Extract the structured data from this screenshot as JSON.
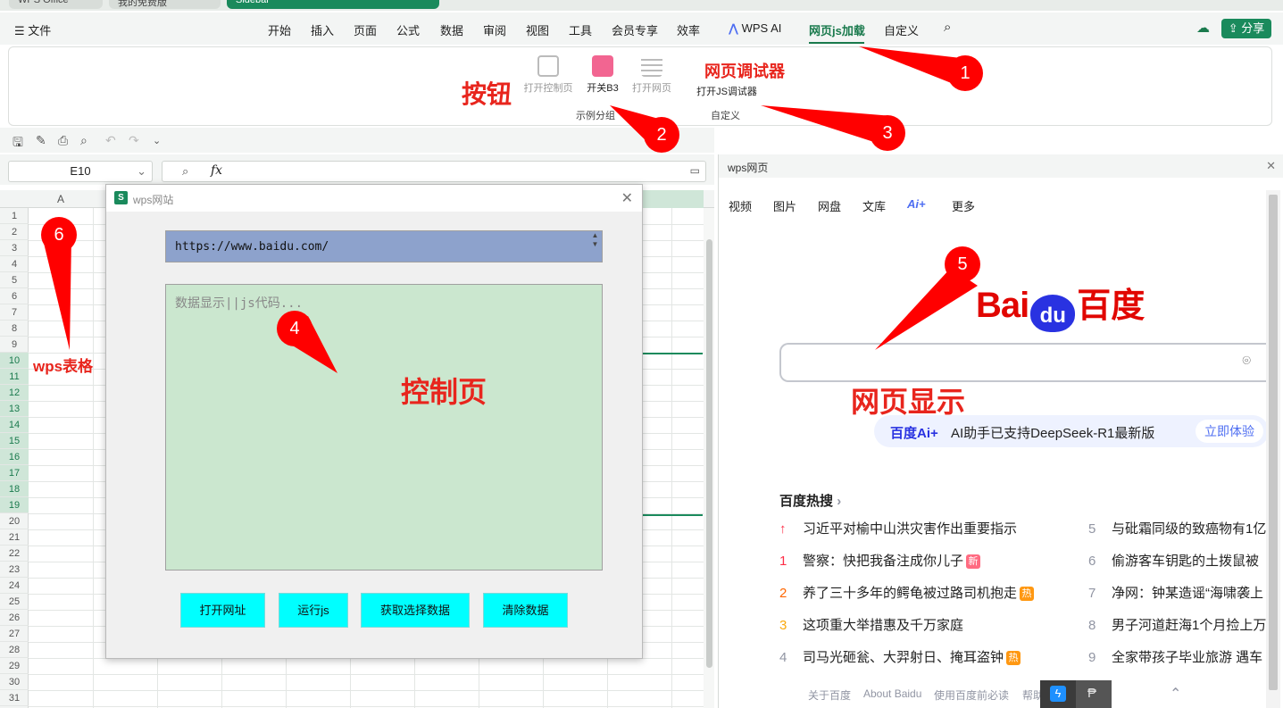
{
  "window_tabs": [
    "WPS Office",
    "我的免费版",
    "Sidebar"
  ],
  "file_menu": "文件",
  "menu": [
    "开始",
    "插入",
    "页面",
    "公式",
    "数据",
    "审阅",
    "视图",
    "工具",
    "会员专享",
    "效率",
    "WPS AI",
    "网页js加载",
    "自定义"
  ],
  "share_label": "分享",
  "ribbon": {
    "buttons": [
      {
        "label": "打开控制页",
        "enabled": false
      },
      {
        "label": "开关B3",
        "enabled": true
      },
      {
        "label": "打开网页",
        "enabled": false
      },
      {
        "label": "打开JS调试器",
        "enabled": true
      }
    ],
    "group_left": "示例分组",
    "group_right": "自定义"
  },
  "formula_bar": {
    "cell_ref": "E10",
    "fx": "fx"
  },
  "sheet": {
    "col_a": "A",
    "rows": [
      "1",
      "2",
      "3",
      "4",
      "5",
      "6",
      "7",
      "8",
      "9",
      "10",
      "11",
      "12",
      "13",
      "14",
      "15",
      "16",
      "17",
      "18",
      "19",
      "20",
      "21",
      "22",
      "23",
      "24",
      "25",
      "26",
      "27",
      "28",
      "29",
      "30",
      "31"
    ],
    "selected_rows_from": 10,
    "selected_rows_to": 19
  },
  "dialog": {
    "title": "wps网站",
    "url": "https://www.baidu.com/",
    "code_placeholder": "数据显示||js代码...",
    "buttons": [
      "打开网址",
      "运行js",
      "获取选择数据",
      "清除数据"
    ]
  },
  "webpane": {
    "title": "wps网页",
    "nav": [
      "视频",
      "图片",
      "网盘",
      "文库",
      "Ai+",
      "更多"
    ],
    "logo_left": "Bai",
    "logo_mid": "du",
    "logo_right": "百度",
    "ai_promo": {
      "brand": "百度Ai+",
      "text": "AI助手已支持DeepSeek-R1最新版",
      "cta": "立即体验"
    },
    "hot_title": "百度热搜",
    "hot_left": [
      {
        "n": "↑",
        "text": "习近平对榆中山洪灾害作出重要指示",
        "badge": ""
      },
      {
        "n": "1",
        "text": "警察：快把我备注成你儿子",
        "badge": "新"
      },
      {
        "n": "2",
        "text": "养了三十多年的鳄龟被过路司机抱走",
        "badge": "热"
      },
      {
        "n": "3",
        "text": "这项重大举措惠及千万家庭",
        "badge": ""
      },
      {
        "n": "4",
        "text": "司马光砸瓮、大羿射日、掩耳盗钟",
        "badge": "热"
      }
    ],
    "hot_right": [
      {
        "n": "5",
        "text": "与砒霜同级的致癌物有1亿"
      },
      {
        "n": "6",
        "text": "偷游客车钥匙的土拨鼠被"
      },
      {
        "n": "7",
        "text": "净网：钟某造谣“海啸袭上"
      },
      {
        "n": "8",
        "text": "男子河道赶海1个月捡上万"
      },
      {
        "n": "9",
        "text": "全家带孩子毕业旅游 遇车"
      }
    ],
    "footer": [
      "关于百度",
      "About Baidu",
      "使用百度前必读",
      "帮助"
    ]
  },
  "annotations": {
    "button_label": "按钮",
    "debugger_label": "网页调试器",
    "control_label": "控制页",
    "web_label": "网页显示",
    "sheet_label": "wps表格",
    "markers": [
      "1",
      "2",
      "3",
      "4",
      "5",
      "6"
    ]
  },
  "colors": {
    "accent_green": "#1a7a4d",
    "url_bg": "#8da2cc",
    "code_bg": "#cbe7cf",
    "button_bg": "#00ffff",
    "annotation_red": "#e8251d",
    "baidu_blue": "#2932e1",
    "baidu_red": "#e10601"
  }
}
